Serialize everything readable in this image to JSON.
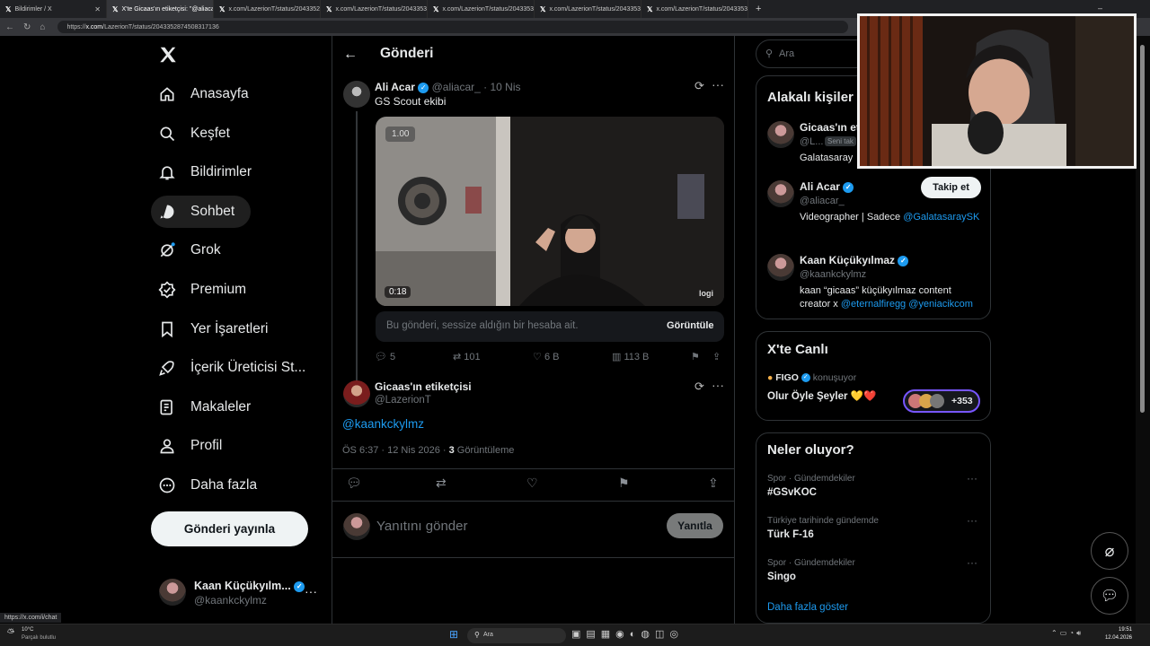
{
  "browser": {
    "tabs": [
      {
        "title": "Bildirimler / X",
        "active": false
      },
      {
        "title": "X'te Gicaas'ın etiketçisi: \"@aliaca",
        "active": true
      },
      {
        "title": "x.com/LazerionT/status/20433529",
        "active": false
      },
      {
        "title": "x.com/LazerionT/status/20433531",
        "active": false
      },
      {
        "title": "x.com/LazerionT/status/20433532",
        "active": false
      },
      {
        "title": "x.com/LazerionT/status/20433534",
        "active": false
      },
      {
        "title": "x.com/LazerionT/status/20433535",
        "active": false
      }
    ],
    "url_prefix": "https://",
    "url_domain": "x.com",
    "url_path": "/LazerionT/status/2043352874508317136",
    "status_url": "https://x.com/i/chat"
  },
  "nav": {
    "items": [
      {
        "label": "Anasayfa",
        "icon": "home-icon"
      },
      {
        "label": "Keşfet",
        "icon": "search-icon"
      },
      {
        "label": "Bildirimler",
        "icon": "bell-icon"
      },
      {
        "label": "Sohbet",
        "icon": "chat-icon"
      },
      {
        "label": "Grok",
        "icon": "grok-icon"
      },
      {
        "label": "Premium",
        "icon": "premium-icon"
      },
      {
        "label": "Yer İşaretleri",
        "icon": "bookmark-icon"
      },
      {
        "label": "İçerik Üreticisi St...",
        "icon": "rocket-icon"
      },
      {
        "label": "Makaleler",
        "icon": "article-icon"
      },
      {
        "label": "Profil",
        "icon": "profile-icon"
      },
      {
        "label": "Daha fazla",
        "icon": "more-circle-icon"
      }
    ],
    "post_button": "Gönderi yayınla",
    "account_name": "Kaan Küçükyılm...",
    "account_handle": "@kaankckylmz"
  },
  "header": {
    "title": "Gönderi"
  },
  "quoted_post": {
    "author": "Ali Acar",
    "handle": "@aliacar_",
    "date": "· 10 Nis",
    "text": "GS Scout ekibi",
    "video_speed": "1.00",
    "video_time": "0:18",
    "video_watermark": "logi",
    "muted_notice": "Bu gönderi, sessize aldığın bir hesaba ait.",
    "view_button": "Görüntüle",
    "replies": "5",
    "reposts": "101",
    "likes": "6 B",
    "views": "113 B"
  },
  "main_post": {
    "author": "Gicaas'ın etiketçisi",
    "handle": "@LazerionT",
    "text": "@kaankckylmz",
    "timestamp": "ÖS 6:37 · 12 Nis 2026 · ",
    "view_count": "3",
    "view_label": " Görüntüleme"
  },
  "reply": {
    "placeholder": "Yanıtını gönder",
    "button": "Yanıtla"
  },
  "search": {
    "placeholder": "Ara"
  },
  "relevant": {
    "title": "Alakalı kişiler",
    "people": [
      {
        "name": "Gicaas'ın et",
        "handle": "@L...",
        "badge": "Seni tak",
        "bio": "Galatasaray"
      },
      {
        "name": "Ali Acar",
        "handle": "@aliacar_",
        "bio": "Videographer | Sadece ",
        "bio_link": "@GalatasaraySK",
        "follow": "Takip et"
      },
      {
        "name": "Kaan Küçükyılmaz",
        "handle": "@kaankckylmz",
        "bio": "kaan “gicaas” küçükyılmaz content creator x ",
        "bio_link": "@eternalfiregg @yeniacikcom"
      }
    ]
  },
  "live": {
    "title": "X'te Canlı",
    "host": "FIGO",
    "host_status": "konuşuyor",
    "space_title": "Olur Öyle Şeyler",
    "space_emoji": "💛❤️",
    "listeners": "+353"
  },
  "trends": {
    "title": "Neler oluyor?",
    "items": [
      {
        "context": "Spor · Gündemdekiler",
        "name": "#GSvKOC"
      },
      {
        "context": "Türkiye tarihinde gündemde",
        "name": "Türk F-16"
      },
      {
        "context": "Spor · Gündemdekiler",
        "name": "Singo"
      }
    ],
    "show_more": "Daha fazla göster"
  },
  "taskbar": {
    "weather_temp": "10°C",
    "weather_desc": "Parçalı bulutlu",
    "search": "Ara",
    "time": "19:51",
    "date": "12.04.2026"
  },
  "colors": {
    "accent": "#1d9bf0",
    "background": "#000000",
    "border": "#2f3336",
    "muted": "#71767b"
  }
}
